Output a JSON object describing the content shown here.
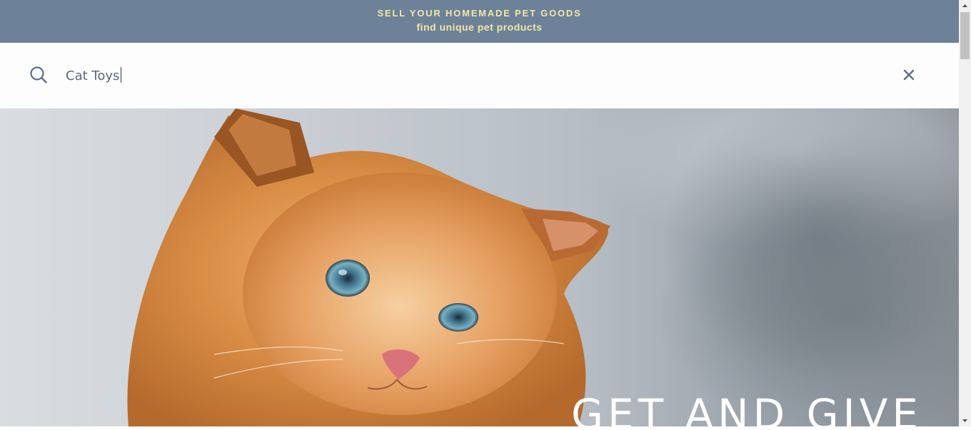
{
  "announcement": {
    "headline": "SELL YOUR HOMEMADE PET GOODS",
    "subline": "find unique pet products"
  },
  "search": {
    "value": "Cat Toys",
    "icon": "search-icon",
    "close_icon": "close-icon"
  },
  "hero": {
    "title": "GET AND GIVE",
    "image": "orange-kitten-photo"
  },
  "colors": {
    "announcement_bg": "#6d8199",
    "announcement_text": "#f3e7a3",
    "icon_color": "#5b6f86"
  }
}
